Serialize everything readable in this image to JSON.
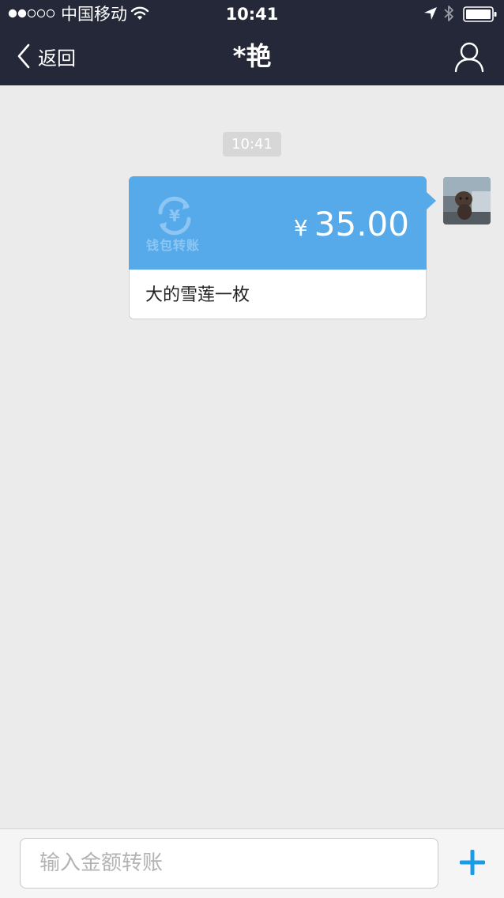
{
  "status_bar": {
    "carrier": "中国移动",
    "time": "10:41",
    "signal_bars_filled": 2,
    "signal_bars_total": 5,
    "icons": [
      "signal-dots-icon",
      "wifi-icon",
      "location-arrow-icon",
      "bluetooth-icon",
      "battery-icon"
    ]
  },
  "nav": {
    "back_label": "返回",
    "title": "*艳",
    "back_icon": "chevron-left-icon",
    "right_icon": "person-icon"
  },
  "chat": {
    "timestamp": "10:41",
    "message": {
      "type": "wallet-transfer",
      "badge_label": "钱包转账",
      "badge_symbol": "¥",
      "currency_symbol": "¥",
      "amount": "35.00",
      "memo": "大的雪莲一枚"
    }
  },
  "input_bar": {
    "placeholder": "输入金额转账",
    "value": "",
    "add_icon": "plus-icon"
  },
  "colors": {
    "nav_bg": "#252838",
    "chat_bg": "#ebebeb",
    "card_blue": "#56aaea",
    "accent": "#1a9be6"
  }
}
